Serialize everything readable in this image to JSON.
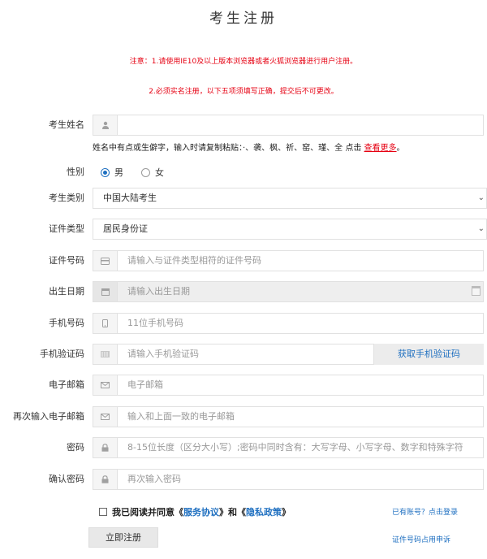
{
  "title": "考生注册",
  "notes": {
    "line1": "注意：1.请使用IE10及以上版本浏览器或者火狐浏览器进行用户注册。",
    "line2": "2.必须实名注册，以下五项须填写正确，提交后不可更改。"
  },
  "name": {
    "label": "考生姓名",
    "hint": "姓名中有点或生僻字，输入时请复制粘贴：·、袭、枫、祈、窑、瑾、全 点击 ",
    "hint_link": "查看更多",
    "hint_end": "。"
  },
  "gender": {
    "label": "性别",
    "options": [
      "男",
      "女"
    ],
    "selected": "男"
  },
  "category": {
    "label": "考生类别",
    "value": "中国大陆考生"
  },
  "idtype": {
    "label": "证件类型",
    "value": "居民身份证"
  },
  "idnum": {
    "label": "证件号码",
    "placeholder": "请输入与证件类型相符的证件号码"
  },
  "birth": {
    "label": "出生日期",
    "placeholder": "请输入出生日期"
  },
  "phone": {
    "label": "手机号码",
    "placeholder": "11位手机号码"
  },
  "sms": {
    "label": "手机验证码",
    "placeholder": "请输入手机验证码",
    "button": "获取手机验证码"
  },
  "email": {
    "label": "电子邮箱",
    "placeholder": "电子邮箱"
  },
  "email2": {
    "label": "再次输入电子邮箱",
    "placeholder": "输入和上面一致的电子邮箱"
  },
  "password": {
    "label": "密码",
    "placeholder": "8-15位长度（区分大小写）;密码中同时含有：大写字母、小写字母、数字和特殊字符"
  },
  "confirm": {
    "label": "确认密码",
    "placeholder": "再次输入密码"
  },
  "agreement": {
    "prefix": "我已阅读并同意《",
    "service": "服务协议",
    "mid": "》和《",
    "privacy": "隐私政策",
    "suffix": "》"
  },
  "links": {
    "login": "已有账号？点击登录",
    "appeal": "证件号码占用申诉"
  },
  "submit": "立即注册",
  "icons": {
    "user": "user-icon",
    "card": "card-icon",
    "calendar": "calendar-icon",
    "phone": "phone-icon",
    "sms": "sms-icon",
    "mail": "mail-icon",
    "lock": "lock-icon"
  }
}
